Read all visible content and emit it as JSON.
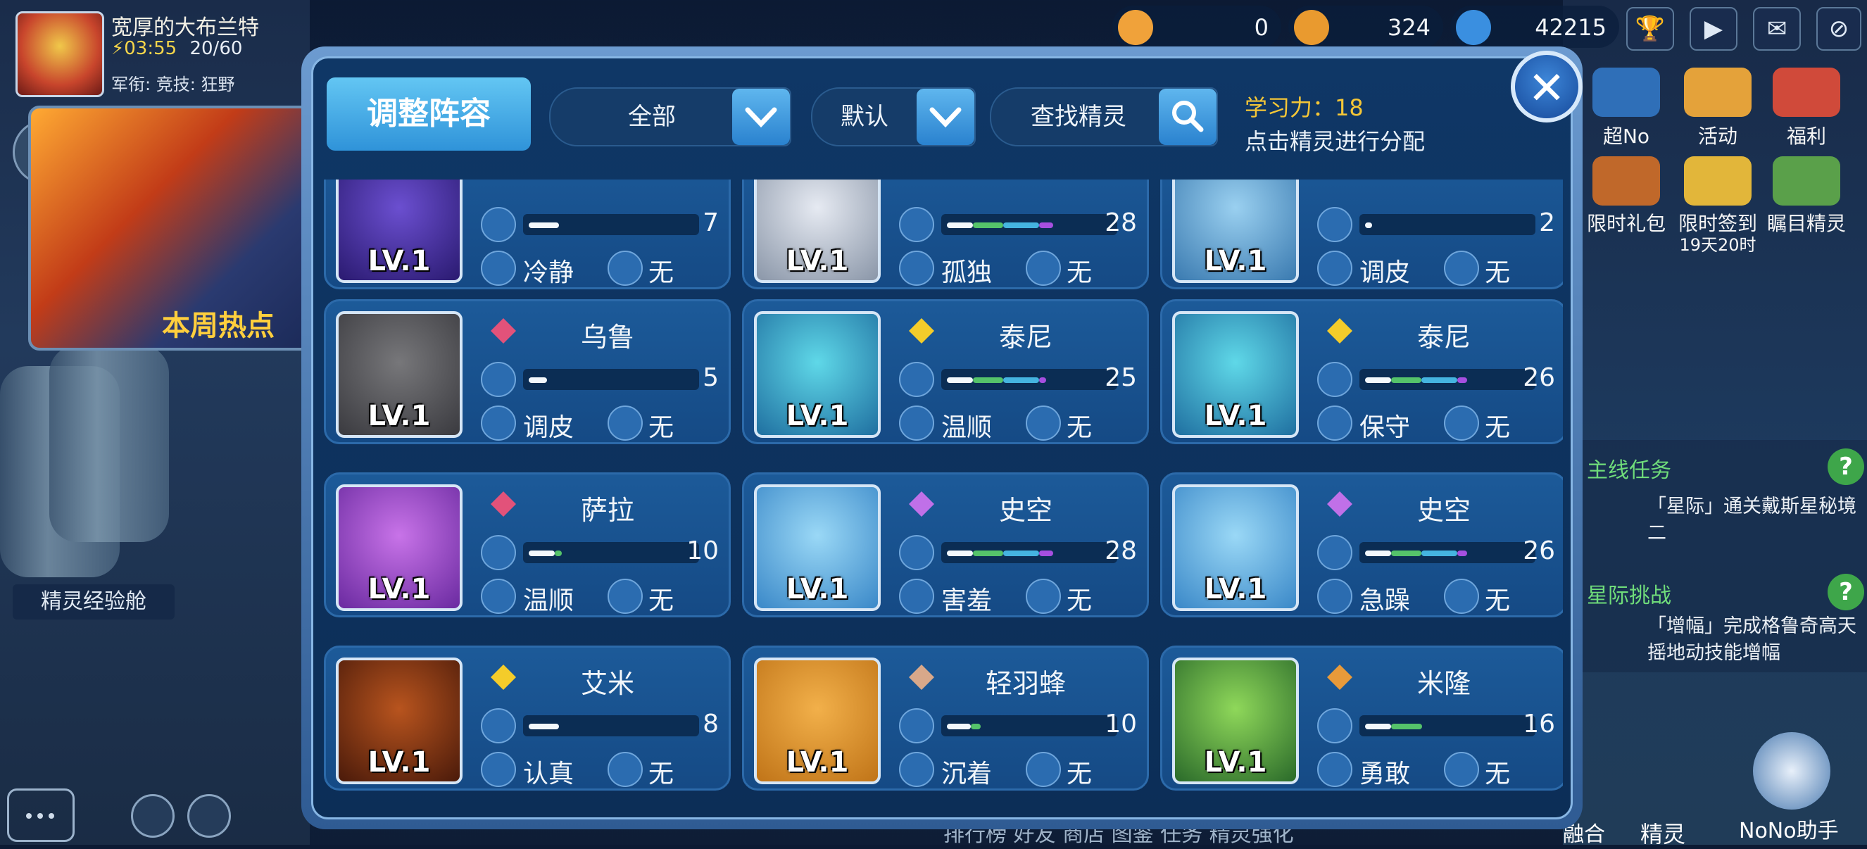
{
  "player": {
    "name": "宽厚的大布兰特",
    "time": "03:55",
    "energy": "20/60",
    "rank_line": "军衔:  竞技:  狂野"
  },
  "left_panel": {
    "hot_text": "本周热点",
    "exp_chamber": "精灵经验舱"
  },
  "resources": [
    {
      "icon": "gold-crate-icon",
      "value": "0",
      "color": "#f0a23a"
    },
    {
      "icon": "gold-truck-icon",
      "value": "324",
      "color": "#e99a2f"
    },
    {
      "icon": "planet-coin-icon",
      "value": "42215",
      "color": "#3a8fe0"
    }
  ],
  "top_icons": [
    "trophy-icon",
    "play-icon",
    "mail-icon",
    "hide-icon"
  ],
  "side_activities": [
    {
      "label": "超No",
      "icon": "robot-icon"
    },
    {
      "label": "活动",
      "icon": "star-icon"
    },
    {
      "label": "福利",
      "icon": "gift-icon"
    },
    {
      "label": "限时礼包",
      "icon": "treasure-icon"
    },
    {
      "label": "限时签到",
      "sub": "19天20时",
      "icon": "checkin-icon"
    },
    {
      "label": "瞩目精灵",
      "icon": "dragon-icon"
    }
  ],
  "tasks": {
    "main_title": "主线任务",
    "main_text": "「星际」通关戴斯星秘境二",
    "challenge_title": "星际挑战",
    "challenge_text": "「增幅」完成格鲁奇高天摇地动技能增幅",
    "help_mark": "?"
  },
  "bottom": {
    "tabs": "排行榜   好友   商店   图鉴   任务   精灵强化",
    "fusion": "融合",
    "spirit": "精灵",
    "nono": "NoNo助手"
  },
  "modal": {
    "title": "调整阵容",
    "filter_all": "全部",
    "sort_default": "默认",
    "search_label": "查找精灵",
    "learn_label": "学习力：",
    "learn_value": "18",
    "hint": "点击精灵进行分配",
    "close": "✕"
  },
  "spirits": [
    {
      "name": "",
      "level": "LV.1",
      "power": "7",
      "fill": 0.25,
      "nature": "冷静",
      "feature": "无",
      "type": "",
      "segments": [
        {
          "c": "#f3f8fc",
          "w": 0.25
        }
      ],
      "portrait": [
        "#6b4fd0",
        "#2a1a70"
      ]
    },
    {
      "name": "",
      "level": "LV.1",
      "power": "28",
      "fill": 0.95,
      "nature": "孤独",
      "feature": "无",
      "type": "",
      "segments": [
        {
          "c": "#f3f8fc",
          "w": 0.22
        },
        {
          "c": "#55c36a",
          "w": 0.25
        },
        {
          "c": "#45b4e0",
          "w": 0.3
        },
        {
          "c": "#a64fe0",
          "w": 0.12
        }
      ],
      "portrait": [
        "#e6eaf2",
        "#8a96a8"
      ]
    },
    {
      "name": "",
      "level": "LV.1",
      "power": "2",
      "fill": 0.06,
      "nature": "调皮",
      "feature": "无",
      "type": "",
      "segments": [
        {
          "c": "#f3f8fc",
          "w": 0.06
        }
      ],
      "portrait": [
        "#9ad0f0",
        "#3a7ab0"
      ]
    },
    {
      "name": "乌鲁",
      "level": "LV.1",
      "power": "5",
      "fill": 0.15,
      "nature": "调皮",
      "feature": "无",
      "type": "fire-type-icon",
      "segments": [
        {
          "c": "#f3f8fc",
          "w": 0.15
        }
      ],
      "portrait": [
        "#77777a",
        "#3a3a3f"
      ]
    },
    {
      "name": "泰尼",
      "level": "LV.1",
      "power": "25",
      "fill": 0.85,
      "nature": "温顺",
      "feature": "无",
      "type": "electric-type-icon",
      "segments": [
        {
          "c": "#f3f8fc",
          "w": 0.22
        },
        {
          "c": "#55c36a",
          "w": 0.25
        },
        {
          "c": "#45b4e0",
          "w": 0.3
        },
        {
          "c": "#a64fe0",
          "w": 0.06
        }
      ],
      "portrait": [
        "#5fd8e8",
        "#1f6fa0"
      ]
    },
    {
      "name": "泰尼",
      "level": "LV.1",
      "power": "26",
      "fill": 0.88,
      "nature": "保守",
      "feature": "无",
      "type": "electric-type-icon",
      "segments": [
        {
          "c": "#f3f8fc",
          "w": 0.22
        },
        {
          "c": "#55c36a",
          "w": 0.25
        },
        {
          "c": "#45b4e0",
          "w": 0.3
        },
        {
          "c": "#a64fe0",
          "w": 0.08
        }
      ],
      "portrait": [
        "#5fd8e8",
        "#1f6fa0"
      ]
    },
    {
      "name": "萨拉",
      "level": "LV.1",
      "power": "10",
      "fill": 0.33,
      "nature": "温顺",
      "feature": "无",
      "type": "fire-type-icon",
      "segments": [
        {
          "c": "#f3f8fc",
          "w": 0.22
        },
        {
          "c": "#55c36a",
          "w": 0.06
        }
      ],
      "portrait": [
        "#c873e8",
        "#6a2aa0"
      ]
    },
    {
      "name": "史空",
      "level": "LV.1",
      "power": "28",
      "fill": 0.95,
      "nature": "害羞",
      "feature": "无",
      "type": "psychic-type-icon",
      "segments": [
        {
          "c": "#f3f8fc",
          "w": 0.22
        },
        {
          "c": "#55c36a",
          "w": 0.25
        },
        {
          "c": "#45b4e0",
          "w": 0.3
        },
        {
          "c": "#a64fe0",
          "w": 0.12
        }
      ],
      "portrait": [
        "#9ad8f6",
        "#3a88c8"
      ]
    },
    {
      "name": "史空",
      "level": "LV.1",
      "power": "26",
      "fill": 0.88,
      "nature": "急躁",
      "feature": "无",
      "type": "psychic-type-icon",
      "segments": [
        {
          "c": "#f3f8fc",
          "w": 0.22
        },
        {
          "c": "#55c36a",
          "w": 0.25
        },
        {
          "c": "#45b4e0",
          "w": 0.3
        },
        {
          "c": "#a64fe0",
          "w": 0.08
        }
      ],
      "portrait": [
        "#9ad8f6",
        "#3a88c8"
      ]
    },
    {
      "name": "艾米",
      "level": "LV.1",
      "power": "8",
      "fill": 0.28,
      "nature": "认真",
      "feature": "无",
      "type": "electric-type-icon",
      "segments": [
        {
          "c": "#f3f8fc",
          "w": 0.25
        }
      ],
      "portrait": [
        "#b8541e",
        "#4a1a0a"
      ]
    },
    {
      "name": "轻羽蜂",
      "level": "LV.1",
      "power": "10",
      "fill": 0.33,
      "nature": "沉着",
      "feature": "无",
      "type": "wing-type-icon",
      "segments": [
        {
          "c": "#f3f8fc",
          "w": 0.2
        },
        {
          "c": "#55c36a",
          "w": 0.08
        }
      ],
      "portrait": [
        "#f2b04a",
        "#c07418"
      ]
    },
    {
      "name": "米隆",
      "level": "LV.1",
      "power": "16",
      "fill": 0.55,
      "nature": "勇敢",
      "feature": "无",
      "type": "ground-type-icon",
      "segments": [
        {
          "c": "#f3f8fc",
          "w": 0.22
        },
        {
          "c": "#55c36a",
          "w": 0.26
        }
      ],
      "portrait": [
        "#8fd85a",
        "#2a6a2a"
      ]
    }
  ]
}
